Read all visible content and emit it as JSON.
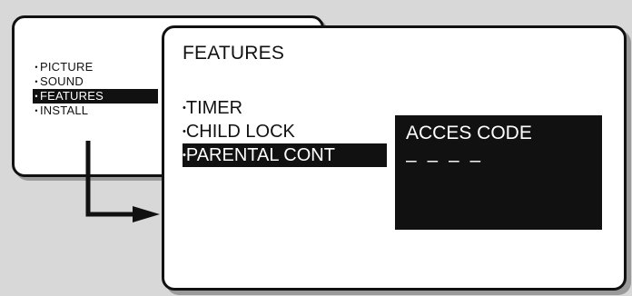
{
  "main_menu": {
    "items": [
      {
        "label": "PICTURE",
        "selected": false
      },
      {
        "label": "SOUND",
        "selected": false
      },
      {
        "label": "FEATURES",
        "selected": true
      },
      {
        "label": "INSTALL",
        "selected": false
      }
    ]
  },
  "features_menu": {
    "title": "FEATURES",
    "items": [
      {
        "label": "TIMER",
        "selected": false
      },
      {
        "label": "CHILD LOCK",
        "selected": false
      },
      {
        "label": "PARENTAL CONT",
        "selected": true
      }
    ]
  },
  "access_code": {
    "label": "ACCES CODE",
    "value": "– – – –"
  },
  "icons": {
    "bullet": "bullet-icon",
    "arrow": "arrow-right-icon"
  },
  "colors": {
    "panel_bg": "#ffffff",
    "highlight_bg": "#111111",
    "highlight_text": "#ffffff",
    "page_bg": "#d8d8d8"
  }
}
